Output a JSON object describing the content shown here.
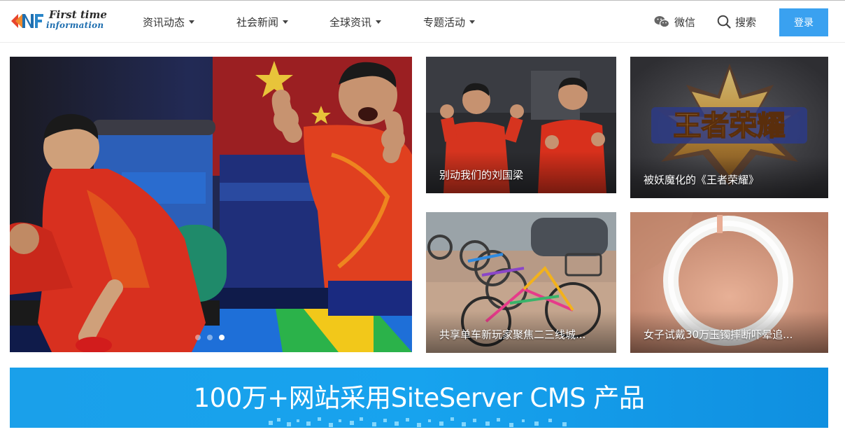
{
  "logo": {
    "line1": "First time",
    "line2": "information",
    "mark_icon": "dnf-logo-icon"
  },
  "nav": [
    {
      "label": "资讯动态"
    },
    {
      "label": "社会新闻"
    },
    {
      "label": "全球资讯"
    },
    {
      "label": "专题活动"
    }
  ],
  "header_right": {
    "wechat_label": "微信",
    "search_label": "搜索",
    "login_label": "登录"
  },
  "carousel": {
    "slide_count": 3,
    "active_index": 2,
    "scene": "table-tennis-celebration-rio-2016"
  },
  "cards": [
    {
      "caption": "别动我们的刘国梁"
    },
    {
      "caption": "被妖魔化的《王者荣耀》"
    },
    {
      "caption": "共享单车新玩家聚焦二三线城..."
    },
    {
      "caption": "女子试戴30万玉镯摔断吓晕追..."
    }
  ],
  "game_logo_text": "王者荣耀",
  "banner": {
    "text": "100万+网站采用SiteServer CMS 产品"
  },
  "colors": {
    "accent": "#3aa1f0",
    "banner_bg": "#1a9be6",
    "nav_text": "#333333"
  }
}
